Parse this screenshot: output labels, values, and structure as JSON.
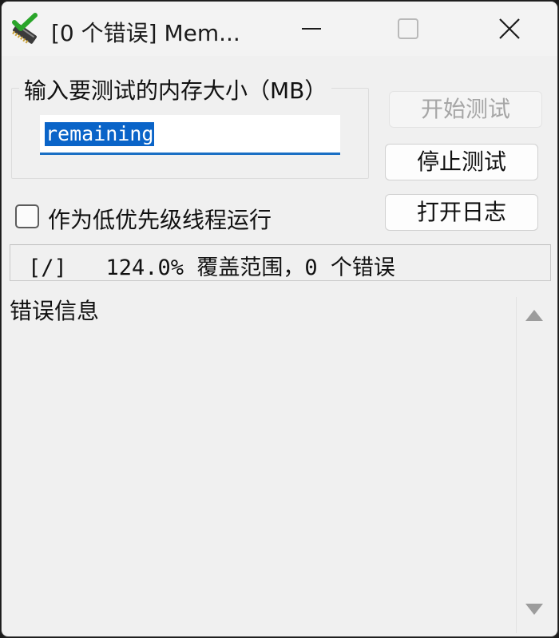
{
  "window": {
    "title": "[0 个错误] Mem...",
    "icon": "memtest-check-icon"
  },
  "test_size": {
    "legend": "输入要测试的内存大小（MB）",
    "value": "remaining"
  },
  "buttons": {
    "start": "开始测试",
    "stop": "停止测试",
    "open_log": "打开日志"
  },
  "low_priority": {
    "label": "作为低优先级线程运行",
    "checked": false
  },
  "status": {
    "text": "[/]   124.0% 覆盖范围，0 个错误"
  },
  "errors": {
    "title": "错误信息"
  },
  "colors": {
    "selection": "#0a64c8",
    "input_underline": "#1a6fc4",
    "window_bg": "#f0f0f0"
  }
}
